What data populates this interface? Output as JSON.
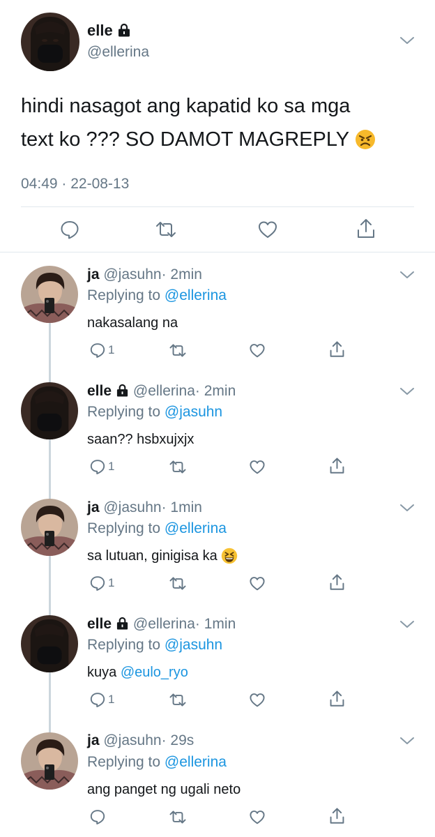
{
  "main_tweet": {
    "name": "elle",
    "handle": "@ellerina",
    "text_line1": "hindi nasagot ang kapatid ko sa mga",
    "text_line2": "text ko ??? SO DAMOT MAGREPLY",
    "text_emoji": "angry-face-emoji",
    "timestamp": "04:49 · 22-08-13",
    "actions": [
      "reply-icon",
      "retweet-icon",
      "like-icon",
      "share-icon"
    ]
  },
  "replies": [
    {
      "name": "ja",
      "handle": "@jasuhn",
      "time": "· 2min",
      "replying_prefix": "Replying to",
      "replying_to": "@ellerina",
      "text": "nakasalang na",
      "reply_count": "1",
      "locked": false
    },
    {
      "name": "elle",
      "handle": "@ellerina",
      "time": "· 2min",
      "replying_prefix": "Replying to",
      "replying_to": "@jasuhn",
      "text": "saan?? hsbxujxjx",
      "reply_count": "1",
      "locked": true
    },
    {
      "name": "ja",
      "handle": "@jasuhn",
      "time": "· 1min",
      "replying_prefix": "Replying to",
      "replying_to": "@ellerina",
      "text": "sa lutuan, ginigisa ka",
      "text_emoji": "grinning-squinting-face-emoji",
      "reply_count": "1",
      "locked": false
    },
    {
      "name": "elle",
      "handle": "@ellerina",
      "time": "· 1min",
      "replying_prefix": "Replying to",
      "replying_to": "@jasuhn",
      "text_prefix": "kuya",
      "text_mention": "@eulo_ryo",
      "reply_count": "1",
      "locked": true
    },
    {
      "name": "ja",
      "handle": "@jasuhn",
      "time": "· 29s",
      "replying_prefix": "Replying to",
      "replying_to": "@ellerina",
      "text": "ang panget ng ugali neto",
      "reply_count": "",
      "locked": false
    }
  ],
  "colors": {
    "link": "#1b95e0",
    "muted": "#657786",
    "text": "#14171a",
    "divider": "#e1e8ed",
    "thread_line": "#ccd6dd"
  }
}
